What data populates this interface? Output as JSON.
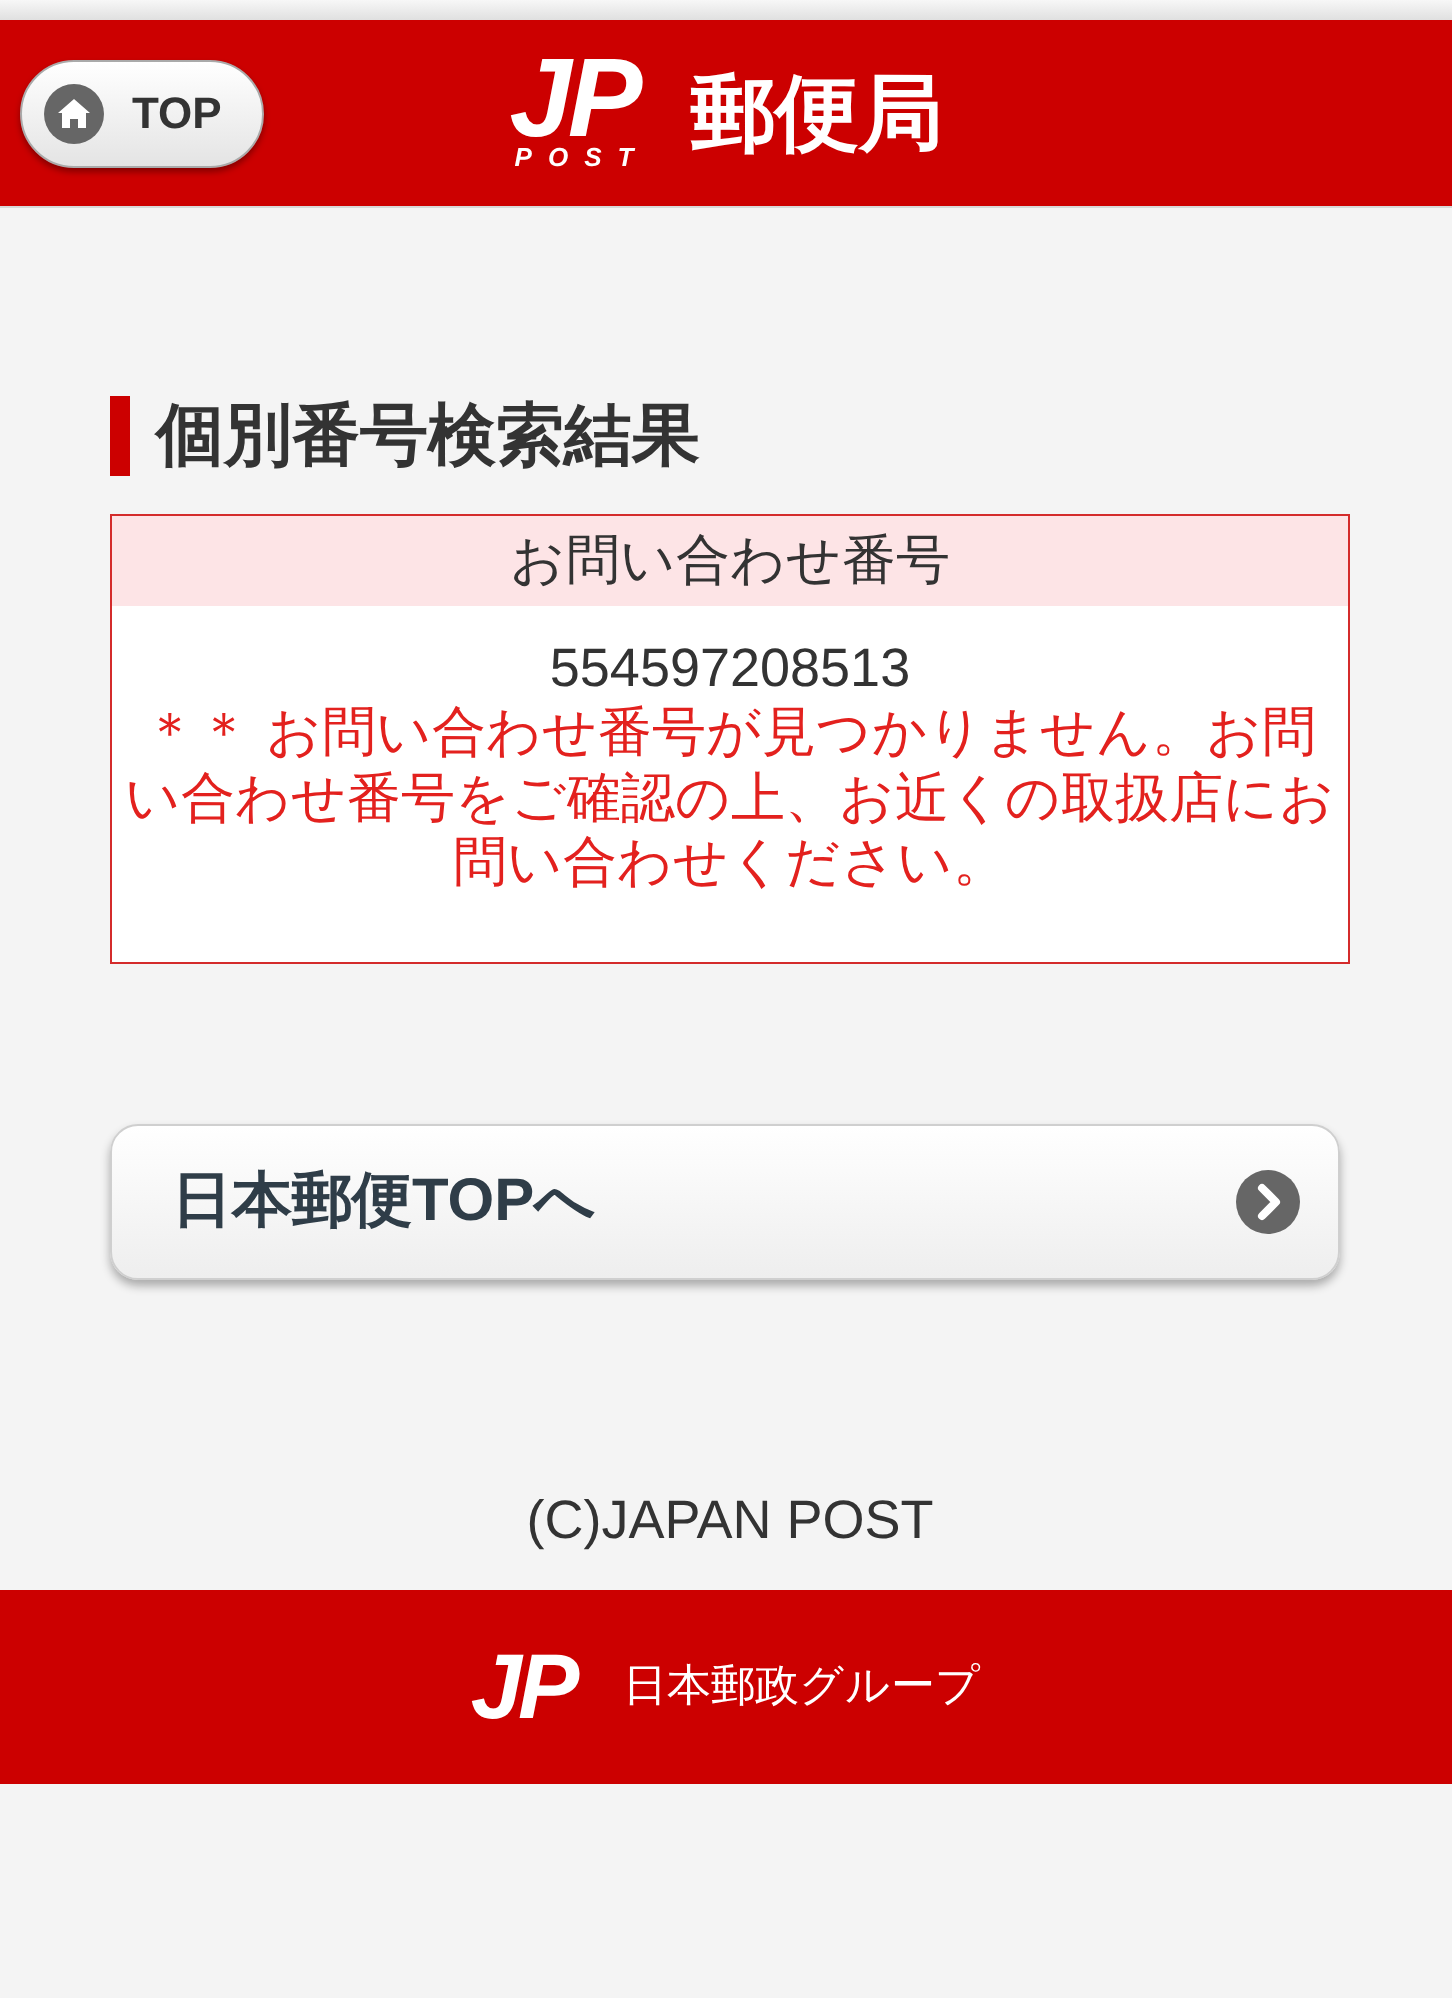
{
  "header": {
    "top_button": {
      "label": "TOP"
    },
    "logo": {
      "mark": "JP",
      "subtitle": "POST"
    },
    "title": "郵便局"
  },
  "page_title": "個別番号検索結果",
  "result": {
    "column_header": "お問い合わせ番号",
    "number": "554597208513",
    "message": "＊＊ お問い合わせ番号が見つかりません。お問い合わせ番号をご確認の上、お近くの取扱店にお問い合わせください。"
  },
  "link_button": {
    "label": "日本郵便TOPへ"
  },
  "copyright": "(C)JAPAN POST",
  "footer": {
    "logo": {
      "mark": "JP"
    },
    "group_name": "日本郵政グループ"
  }
}
